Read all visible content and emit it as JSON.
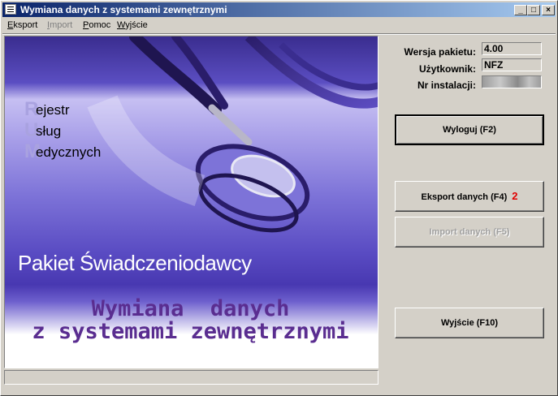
{
  "window": {
    "title": "Wymiana danych z systemami zewnętrznymi"
  },
  "titlebar_buttons": {
    "minimize": "_",
    "maximize": "□",
    "close": "×"
  },
  "menu": [
    {
      "label": "Eksport",
      "underline": "E",
      "rest": "ksport",
      "enabled": true
    },
    {
      "label": "Import",
      "underline": "I",
      "rest": "mport",
      "enabled": false
    },
    {
      "label": "Pomoc",
      "underline": "P",
      "rest": "omoc",
      "enabled": true
    },
    {
      "label": "Wyjście",
      "underline": "W",
      "rest": "yjście",
      "enabled": true
    }
  ],
  "banner": {
    "rum": [
      {
        "letter": "R",
        "word": "ejestr"
      },
      {
        "letter": "U",
        "word": "sług"
      },
      {
        "letter": "M",
        "word": "edycznych"
      }
    ],
    "product": "Pakiet Świadczeniodawcy",
    "headline_line1": "Wymiana  danych",
    "headline_line2": "z systemami zewnętrznymi"
  },
  "info": {
    "version_label": "Wersja pakietu:",
    "version_value": "4.00",
    "user_label": "Użytkownik:",
    "user_value": "NFZ",
    "install_label": "Nr instalacji:",
    "install_value": ""
  },
  "buttons": {
    "logout": "Wyloguj (F2)",
    "export": "Eksport danych (F4)",
    "export_badge": "2",
    "import": "Import danych (F5)",
    "exit": "Wyjście (F10)"
  },
  "colors": {
    "titlebar_start": "#0a246a",
    "titlebar_end": "#a6caf0",
    "headline": "#5a2d90",
    "badge": "#e00000"
  }
}
